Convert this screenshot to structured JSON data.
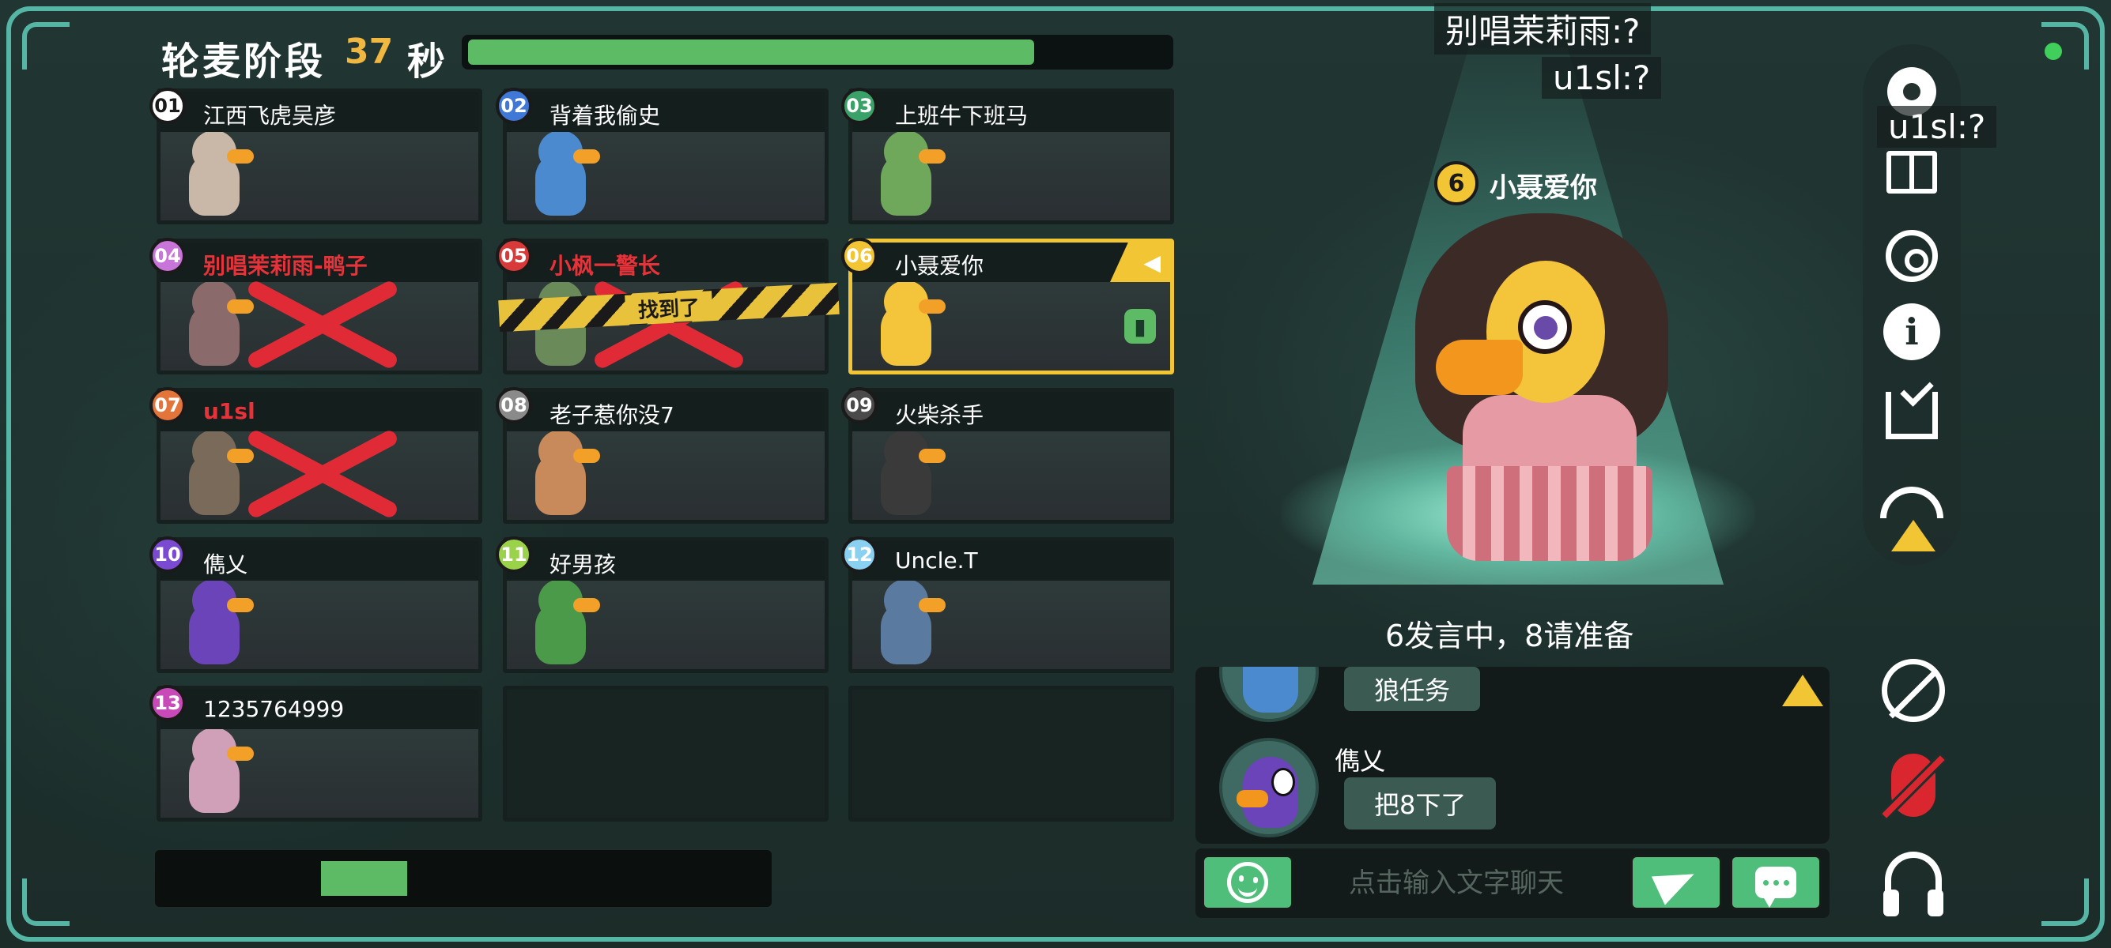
{
  "phase": {
    "title": "轮麦阶段",
    "seconds": "37",
    "unit": "秒",
    "progress": 0.81
  },
  "players": [
    {
      "num": "01",
      "name": "江西飞虎吴彦",
      "badge_color": "#ffffff",
      "duck_color": "#c9b8a8",
      "status": "alive"
    },
    {
      "num": "02",
      "name": "背着我偷史",
      "badge_color": "#3f78d6",
      "duck_color": "#4c8ad0",
      "status": "alive"
    },
    {
      "num": "03",
      "name": "上班牛下班马",
      "badge_color": "#3aa168",
      "duck_color": "#6fa85a",
      "status": "alive"
    },
    {
      "num": "04",
      "name": "别唱茉莉雨-鸭子",
      "badge_color": "#c874d8",
      "duck_color": "#8a6a6a",
      "status": "dead"
    },
    {
      "num": "05",
      "name": "小枫一警长",
      "badge_color": "#d83a3a",
      "duck_color": "#6a8a5a",
      "status": "found",
      "tape_label": "找到了"
    },
    {
      "num": "06",
      "name": "小聂爱你",
      "badge_color": "#f2c534",
      "duck_color": "#f4c53a",
      "status": "speaking"
    },
    {
      "num": "07",
      "name": "u1sl",
      "badge_color": "#e4753a",
      "duck_color": "#7a6a5a",
      "status": "dead"
    },
    {
      "num": "08",
      "name": "老子惹你没7",
      "badge_color": "#8a8a8a",
      "duck_color": "#c88a5a",
      "status": "alive"
    },
    {
      "num": "09",
      "name": "火柴杀手",
      "badge_color": "#4a4a4a",
      "duck_color": "#3a3a3a",
      "status": "alive"
    },
    {
      "num": "10",
      "name": "儁乂",
      "badge_color": "#7a4ad0",
      "duck_color": "#6a44b8",
      "status": "alive"
    },
    {
      "num": "11",
      "name": "好男孩",
      "badge_color": "#9ad24a",
      "duck_color": "#4a9a4a",
      "status": "alive"
    },
    {
      "num": "12",
      "name": "Uncle.T",
      "badge_color": "#8ad0f0",
      "duck_color": "#5a7aa0",
      "status": "alive"
    },
    {
      "num": "13",
      "name": "1235764999",
      "badge_color": "#c84ab8",
      "duck_color": "#d0a0b8",
      "status": "alive"
    }
  ],
  "bottom_progress": 0.14,
  "speaker": {
    "num": "6",
    "name": "小聂爱你"
  },
  "whispers": [
    "别唱茉莉雨:?",
    "u1sl:?",
    "u1sl:?"
  ],
  "speaking_notice": "6发言中，8请准备",
  "chat": {
    "messages": [
      {
        "sender": "",
        "text": "狼任务",
        "avatar_color": "#4c8ad0"
      },
      {
        "sender": "儁乂",
        "text": "把8下了",
        "avatar_color": "#6a44b8"
      }
    ],
    "input_placeholder": "点击输入文字聊天"
  },
  "icons": {
    "settings": "gear-icon",
    "rules": "book-icon",
    "replay": "replay-icon",
    "info": "info-icon",
    "tasks": "checklist-icon",
    "hide": "hide-icon",
    "mic": "mic-muted-icon",
    "audio": "headset-icon",
    "emoji": "emoji-icon",
    "send": "send-icon",
    "quick_chat": "chat-bubble-icon"
  },
  "colors": {
    "accent": "#56b6a6",
    "progress": "#5dbb65",
    "highlight": "#f2c534",
    "dead": "#e8323a"
  }
}
